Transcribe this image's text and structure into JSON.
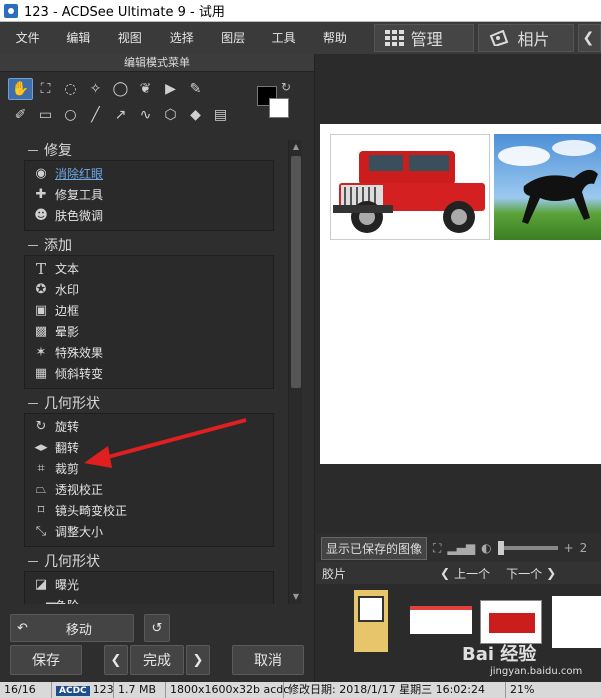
{
  "window": {
    "title": "123 - ACDSee Ultimate 9 - 试用"
  },
  "menu": {
    "items": [
      "文件(F)",
      "编辑(E)",
      "视图(V)",
      "选择(S)",
      "图层(L)",
      "工具(T)",
      "帮助(H)"
    ],
    "mode_buttons": [
      {
        "label": "管理",
        "icon": "grid-icon"
      },
      {
        "label": "相片",
        "icon": "photo-icon"
      }
    ]
  },
  "left_panel": {
    "title": "编辑模式菜单",
    "sections": [
      {
        "label": "修复",
        "items": [
          {
            "label": "消除红眼",
            "icon": "eye-icon",
            "link": true
          },
          {
            "label": "修复工具",
            "icon": "bandage-icon"
          },
          {
            "label": "肤色微调",
            "icon": "person-icon"
          }
        ]
      },
      {
        "label": "添加",
        "items": [
          {
            "label": "文本",
            "icon": "text-icon"
          },
          {
            "label": "水印",
            "icon": "watermark-icon"
          },
          {
            "label": "边框",
            "icon": "border-icon"
          },
          {
            "label": "晕影",
            "icon": "vignette-icon"
          },
          {
            "label": "特殊效果",
            "icon": "magic-wand-icon"
          },
          {
            "label": "倾斜转变",
            "icon": "tilt-shift-icon"
          }
        ]
      },
      {
        "label": "几何形状",
        "items": [
          {
            "label": "旋转",
            "icon": "rotate-icon"
          },
          {
            "label": "翻转",
            "icon": "flip-icon"
          },
          {
            "label": "裁剪",
            "icon": "crop-icon"
          },
          {
            "label": "透视校正",
            "icon": "perspective-icon"
          },
          {
            "label": "镜头畸变校正",
            "icon": "lens-icon"
          },
          {
            "label": "调整大小",
            "icon": "resize-icon"
          }
        ]
      },
      {
        "label": "几何形状",
        "items": [
          {
            "label": "曝光",
            "icon": "exposure-icon"
          },
          {
            "label": "色阶",
            "icon": "levels-icon"
          }
        ]
      }
    ],
    "move_button": "移动",
    "save_button": "保存",
    "done_button": "完成",
    "cancel_button": "取消"
  },
  "viewer": {
    "show_saved_label": "显示已保存的图像",
    "zoom_partial": "2"
  },
  "filmstrip": {
    "label": "胶片",
    "prev_label": "上一个",
    "next_label": "下一个"
  },
  "statusbar": {
    "index": "16/16",
    "format_badge": "ACDC",
    "file_name": "123",
    "file_size": "1.7 MB",
    "dimensions": "1800x1600x32b acdc",
    "modified": "修改日期: 2018/1/17 星期三 16:02:24",
    "zoom": "21%"
  },
  "watermark": {
    "text": "Bai 经验",
    "sub": "jingyan.baidu.com"
  },
  "colors": {
    "accent": "#3f6ea8",
    "link": "#6fa8e6",
    "arrow": "#e02020"
  }
}
